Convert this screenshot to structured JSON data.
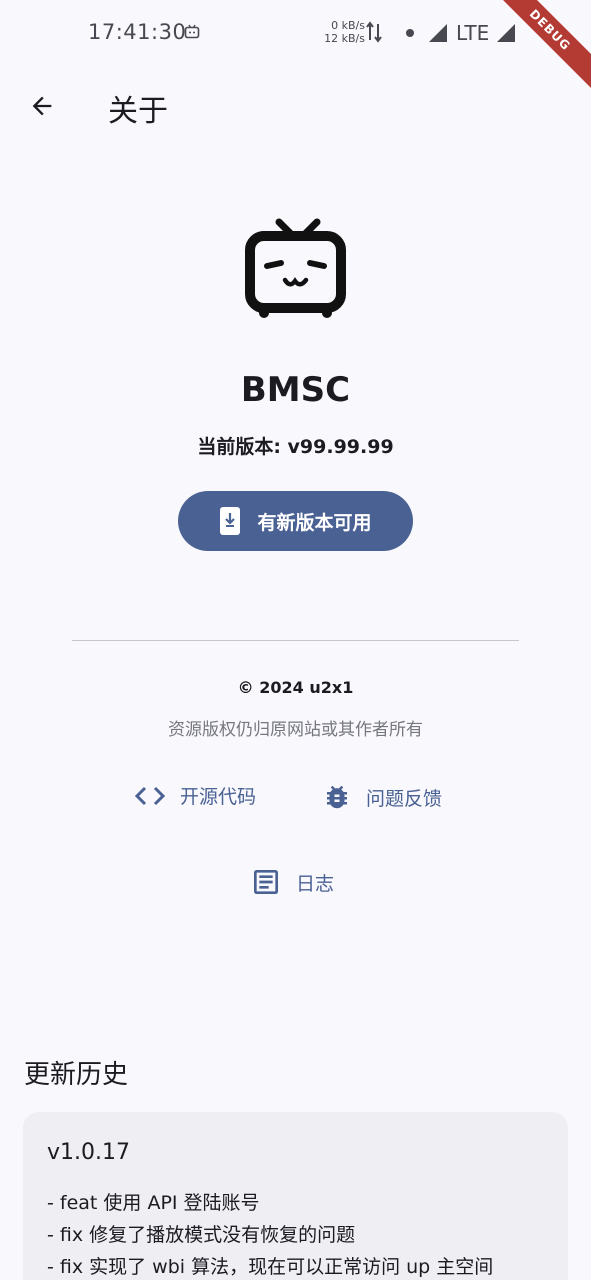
{
  "status_bar": {
    "time": "17:41:30",
    "net_up": "0 kB/s",
    "net_down": "12 kB/s",
    "network": "LTE"
  },
  "debug_ribbon": "DEBUG",
  "app_bar": {
    "title": "关于",
    "back_icon": "arrow-left-icon"
  },
  "app": {
    "name": "BMSC",
    "version_label": "当前版本: v99.99.99",
    "update_button": "有新版本可用",
    "update_icon": "phone-download-icon"
  },
  "footer": {
    "copyright": "© 2024 u2x1",
    "disclaimer": "资源版权仍归原网站或其作者所有"
  },
  "links": {
    "source_code": "开源代码",
    "feedback": "问题反馈",
    "log": "日志"
  },
  "history": {
    "title": "更新历史",
    "entries": [
      {
        "version": "v1.0.17",
        "lines": [
          "- feat 使用 API 登陆账号",
          "- fix 修复了播放模式没有恢复的问题",
          "- fix 实现了 wbi 算法，现在可以正常访问 up 主空间"
        ]
      }
    ]
  },
  "colors": {
    "background": "#f8f8fd",
    "primary": "#4a6193",
    "card": "#eeeef3",
    "debug": "#b43a34"
  }
}
